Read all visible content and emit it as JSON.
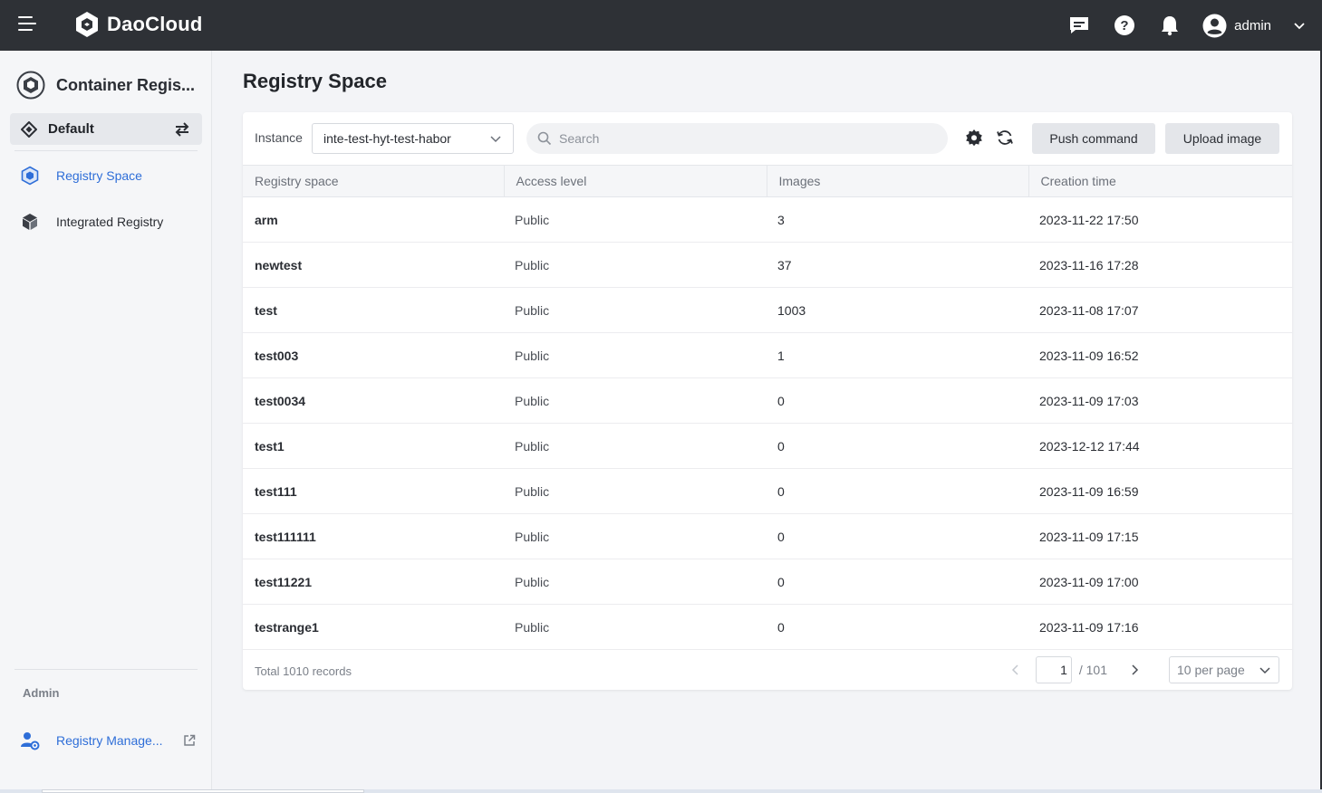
{
  "header": {
    "brand": "DaoCloud",
    "user": "admin",
    "icons": [
      "menu-icon",
      "message-icon",
      "help-icon",
      "bell-icon",
      "user-avatar-icon",
      "chevron-down-icon"
    ]
  },
  "sidebar": {
    "app_title": "Container Regis...",
    "workspace": "Default",
    "items": [
      {
        "label": "Registry Space",
        "icon": "cube-outline-icon",
        "active": true
      },
      {
        "label": "Integrated Registry",
        "icon": "cube-solid-icon",
        "active": false
      }
    ],
    "admin_label": "Admin",
    "admin_items": [
      {
        "label": "Registry Manage...",
        "icon": "user-gear-icon"
      }
    ]
  },
  "main": {
    "page_title": "Registry Space",
    "toolbar": {
      "instance_label": "Instance",
      "instance_value": "inte-test-hyt-test-habor",
      "search_placeholder": "Search",
      "push_label": "Push command",
      "upload_label": "Upload image"
    },
    "table": {
      "columns": [
        "Registry space",
        "Access level",
        "Images",
        "Creation time"
      ],
      "rows": [
        {
          "name": "arm",
          "level": "Public",
          "images": "3",
          "time": "2023-11-22 17:50"
        },
        {
          "name": "newtest",
          "level": "Public",
          "images": "37",
          "time": "2023-11-16 17:28"
        },
        {
          "name": "test",
          "level": "Public",
          "images": "1003",
          "time": "2023-11-08 17:07"
        },
        {
          "name": "test003",
          "level": "Public",
          "images": "1",
          "time": "2023-11-09 16:52"
        },
        {
          "name": "test0034",
          "level": "Public",
          "images": "0",
          "time": "2023-11-09 17:03"
        },
        {
          "name": "test1",
          "level": "Public",
          "images": "0",
          "time": "2023-12-12 17:44"
        },
        {
          "name": "test111",
          "level": "Public",
          "images": "0",
          "time": "2023-11-09 16:59"
        },
        {
          "name": "test111111",
          "level": "Public",
          "images": "0",
          "time": "2023-11-09 17:15"
        },
        {
          "name": "test11221",
          "level": "Public",
          "images": "0",
          "time": "2023-11-09 17:00"
        },
        {
          "name": "testrange1",
          "level": "Public",
          "images": "0",
          "time": "2023-11-09 17:16"
        }
      ]
    },
    "footer": {
      "total": "Total 1010 records",
      "page": "1",
      "pages": "/ 101",
      "per_page": "10 per page"
    }
  },
  "colors": {
    "topbar": "#2e3136",
    "accent": "#2e6ed8",
    "sidebar_bg": "#f5f6f8"
  }
}
